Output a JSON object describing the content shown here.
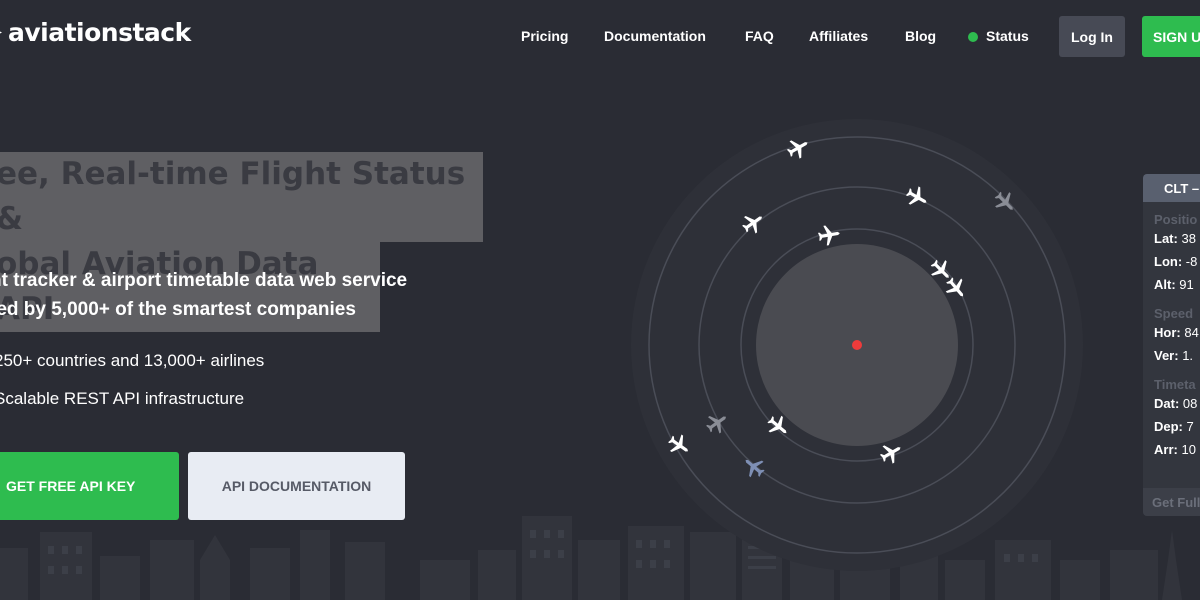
{
  "logo": {
    "text": "aviationstack"
  },
  "nav": {
    "items": [
      {
        "label": "Pricing"
      },
      {
        "label": "Documentation"
      },
      {
        "label": "FAQ"
      },
      {
        "label": "Affiliates"
      },
      {
        "label": "Blog"
      },
      {
        "label": "Status"
      }
    ],
    "login_label": "Log In",
    "signup_label": "SIGN U",
    "status_color": "#2ebc4f"
  },
  "hero": {
    "title_line1": "ee, Real-time Flight Status &",
    "title_line2": "obal Aviation Data API",
    "subtitle_line1": "ht tracker & airport timetable data web service",
    "subtitle_line2": "ted by 5,000+ of the smartest companies",
    "bullets": [
      "250+ countries and 13,000+ airlines",
      "Scalable REST API infrastructure"
    ],
    "primary_button": "GET FREE API KEY",
    "secondary_button": "API DOCUMENTATION"
  },
  "flight_panel": {
    "header": "CLT –",
    "position_title": "Positio",
    "lat_label": "Lat:",
    "lat_value": "38",
    "lon_label": "Lon:",
    "lon_value": "-8",
    "alt_label": "Alt:",
    "alt_value": "91",
    "speed_title": "Speed",
    "hor_label": "Hor:",
    "hor_value": "84",
    "ver_label": "Ver:",
    "ver_value": "1.",
    "timetable_title": "Timeta",
    "dat_label": "Dat:",
    "dat_value": "08",
    "dep_label": "Dep:",
    "dep_value": "7",
    "arr_label": "Arr:",
    "arr_value": "10",
    "footer": "Get Full"
  },
  "colors": {
    "background": "#2a2c34",
    "accent_green": "#2ebc4f",
    "radar_center": "#ef3b3b"
  }
}
